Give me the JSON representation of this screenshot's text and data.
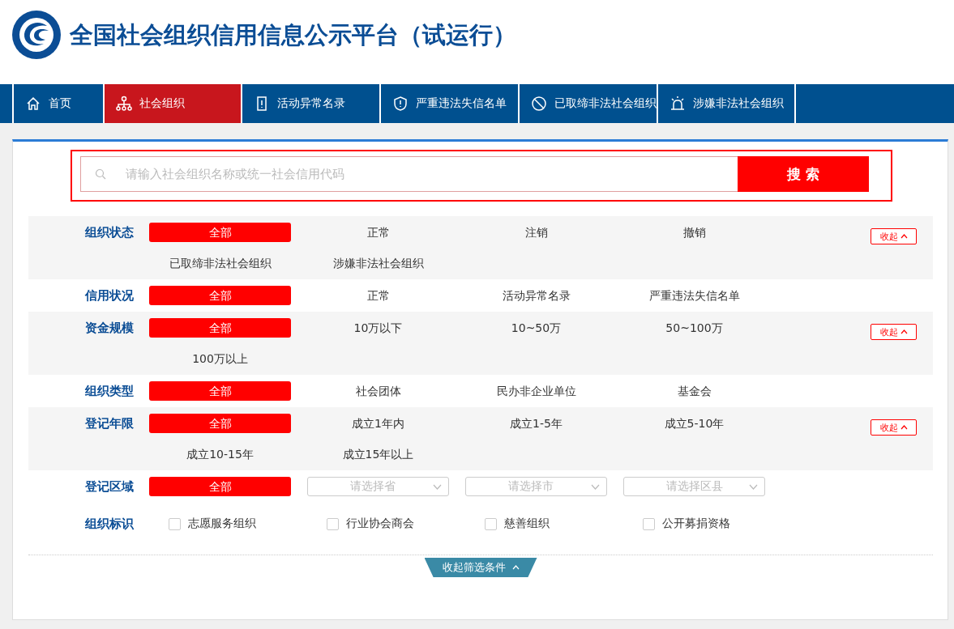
{
  "header": {
    "title": "全国社会组织信用信息公示平台（试运行）"
  },
  "nav": [
    {
      "label": "首页",
      "kind": "home",
      "selected": false
    },
    {
      "label": "社会组织",
      "kind": "organizations",
      "selected": true
    },
    {
      "label": "活动异常名录",
      "kind": "abnormal",
      "selected": false
    },
    {
      "label": "严重违法失信名单",
      "kind": "blacklist",
      "selected": false
    },
    {
      "label": "已取缔非法社会组织",
      "kind": "banned",
      "selected": false
    },
    {
      "label": "涉嫌非法社会组织",
      "kind": "suspected",
      "selected": false
    }
  ],
  "search": {
    "placeholder": "请输入社会组织名称或统一社会信用代码",
    "button": "搜 索"
  },
  "filters": [
    {
      "kind": "options",
      "label": "组织状态",
      "collapse": "收起",
      "options": [
        {
          "label": "全部",
          "selected": true
        },
        {
          "label": "正常",
          "selected": false
        },
        {
          "label": "注销",
          "selected": false
        },
        {
          "label": "撤销",
          "selected": false
        },
        {
          "label": "已取缔非法社会组织",
          "selected": false
        },
        {
          "label": "涉嫌非法社会组织",
          "selected": false
        }
      ]
    },
    {
      "kind": "options",
      "label": "信用状况",
      "options": [
        {
          "label": "全部",
          "selected": true
        },
        {
          "label": "正常",
          "selected": false
        },
        {
          "label": "活动异常名录",
          "selected": false
        },
        {
          "label": "严重违法失信名单",
          "selected": false
        }
      ]
    },
    {
      "kind": "options",
      "label": "资金规模",
      "collapse": "收起",
      "options": [
        {
          "label": "全部",
          "selected": true
        },
        {
          "label": "10万以下",
          "selected": false
        },
        {
          "label": "10~50万",
          "selected": false
        },
        {
          "label": "50~100万",
          "selected": false
        },
        {
          "label": "100万以上",
          "selected": false
        }
      ]
    },
    {
      "kind": "options",
      "label": "组织类型",
      "options": [
        {
          "label": "全部",
          "selected": true
        },
        {
          "label": "社会团体",
          "selected": false
        },
        {
          "label": "民办非企业单位",
          "selected": false
        },
        {
          "label": "基金会",
          "selected": false
        }
      ]
    },
    {
      "kind": "options",
      "label": "登记年限",
      "collapse": "收起",
      "options": [
        {
          "label": "全部",
          "selected": true
        },
        {
          "label": "成立1年内",
          "selected": false
        },
        {
          "label": "成立1-5年",
          "selected": false
        },
        {
          "label": "成立5-10年",
          "selected": false
        },
        {
          "label": "成立10-15年",
          "selected": false
        },
        {
          "label": "成立15年以上",
          "selected": false
        }
      ]
    },
    {
      "kind": "selects",
      "label": "登记区域",
      "all": {
        "label": "全部",
        "selected": true
      },
      "selects": [
        {
          "placeholder": "请选择省"
        },
        {
          "placeholder": "请选择市"
        },
        {
          "placeholder": "请选择区县"
        }
      ]
    },
    {
      "kind": "checkboxes",
      "label": "组织标识",
      "options": [
        {
          "label": "志愿服务组织",
          "checked": false
        },
        {
          "label": "行业协会商会",
          "checked": false
        },
        {
          "label": "慈善组织",
          "checked": false
        },
        {
          "label": "公开募捐资格",
          "checked": false
        }
      ]
    }
  ],
  "toggle": {
    "label": "收起筛选条件"
  }
}
